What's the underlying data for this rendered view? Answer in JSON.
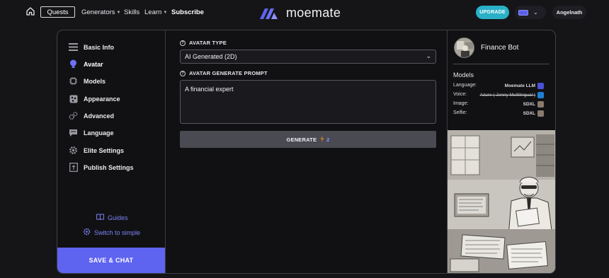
{
  "nav": {
    "quests_label": "Quests",
    "generators_label": "Generators",
    "skills_label": "Skills",
    "learn_label": "Learn",
    "subscribe_label": "Subscribe",
    "logo_text": "moemate",
    "upgrade_label": "UPGRADE",
    "user_name": "Angelnath",
    "accent": "#5e63f0",
    "upgrade_color": "#2ab1c7"
  },
  "sidebar": {
    "items": [
      {
        "label": "Basic Info",
        "icon": "list-icon"
      },
      {
        "label": "Avatar",
        "icon": "bulb-icon"
      },
      {
        "label": "Models",
        "icon": "chip-icon"
      },
      {
        "label": "Appearance",
        "icon": "palette-icon"
      },
      {
        "label": "Advanced",
        "icon": "gears-icon"
      },
      {
        "label": "Language",
        "icon": "chat-icon"
      },
      {
        "label": "Elite Settings",
        "icon": "gear-icon"
      },
      {
        "label": "Publish Settings",
        "icon": "publish-icon"
      }
    ],
    "guides_label": "Guides",
    "switch_label": "Switch to simple",
    "save_chat_label": "SAVE & CHAT"
  },
  "form": {
    "avatar_type_label": "AVATAR TYPE",
    "avatar_type_value": "AI Generated (2D)",
    "prompt_label": "AVATAR GENERATE PROMPT",
    "prompt_value": "A financial expert",
    "generate_label": "GENERATE",
    "generate_cost": "2"
  },
  "bot": {
    "name": "Finance Bot",
    "models_title": "Models",
    "models": [
      {
        "label": "Language:",
        "value": "Moemate LLM",
        "strike": false
      },
      {
        "label": "Voice:",
        "value": "Azure ( Jenny Multilingual )",
        "strike": true
      },
      {
        "label": "Image:",
        "value": "SDXL",
        "strike": false
      },
      {
        "label": "Selfie:",
        "value": "SDXL",
        "strike": false
      }
    ]
  }
}
